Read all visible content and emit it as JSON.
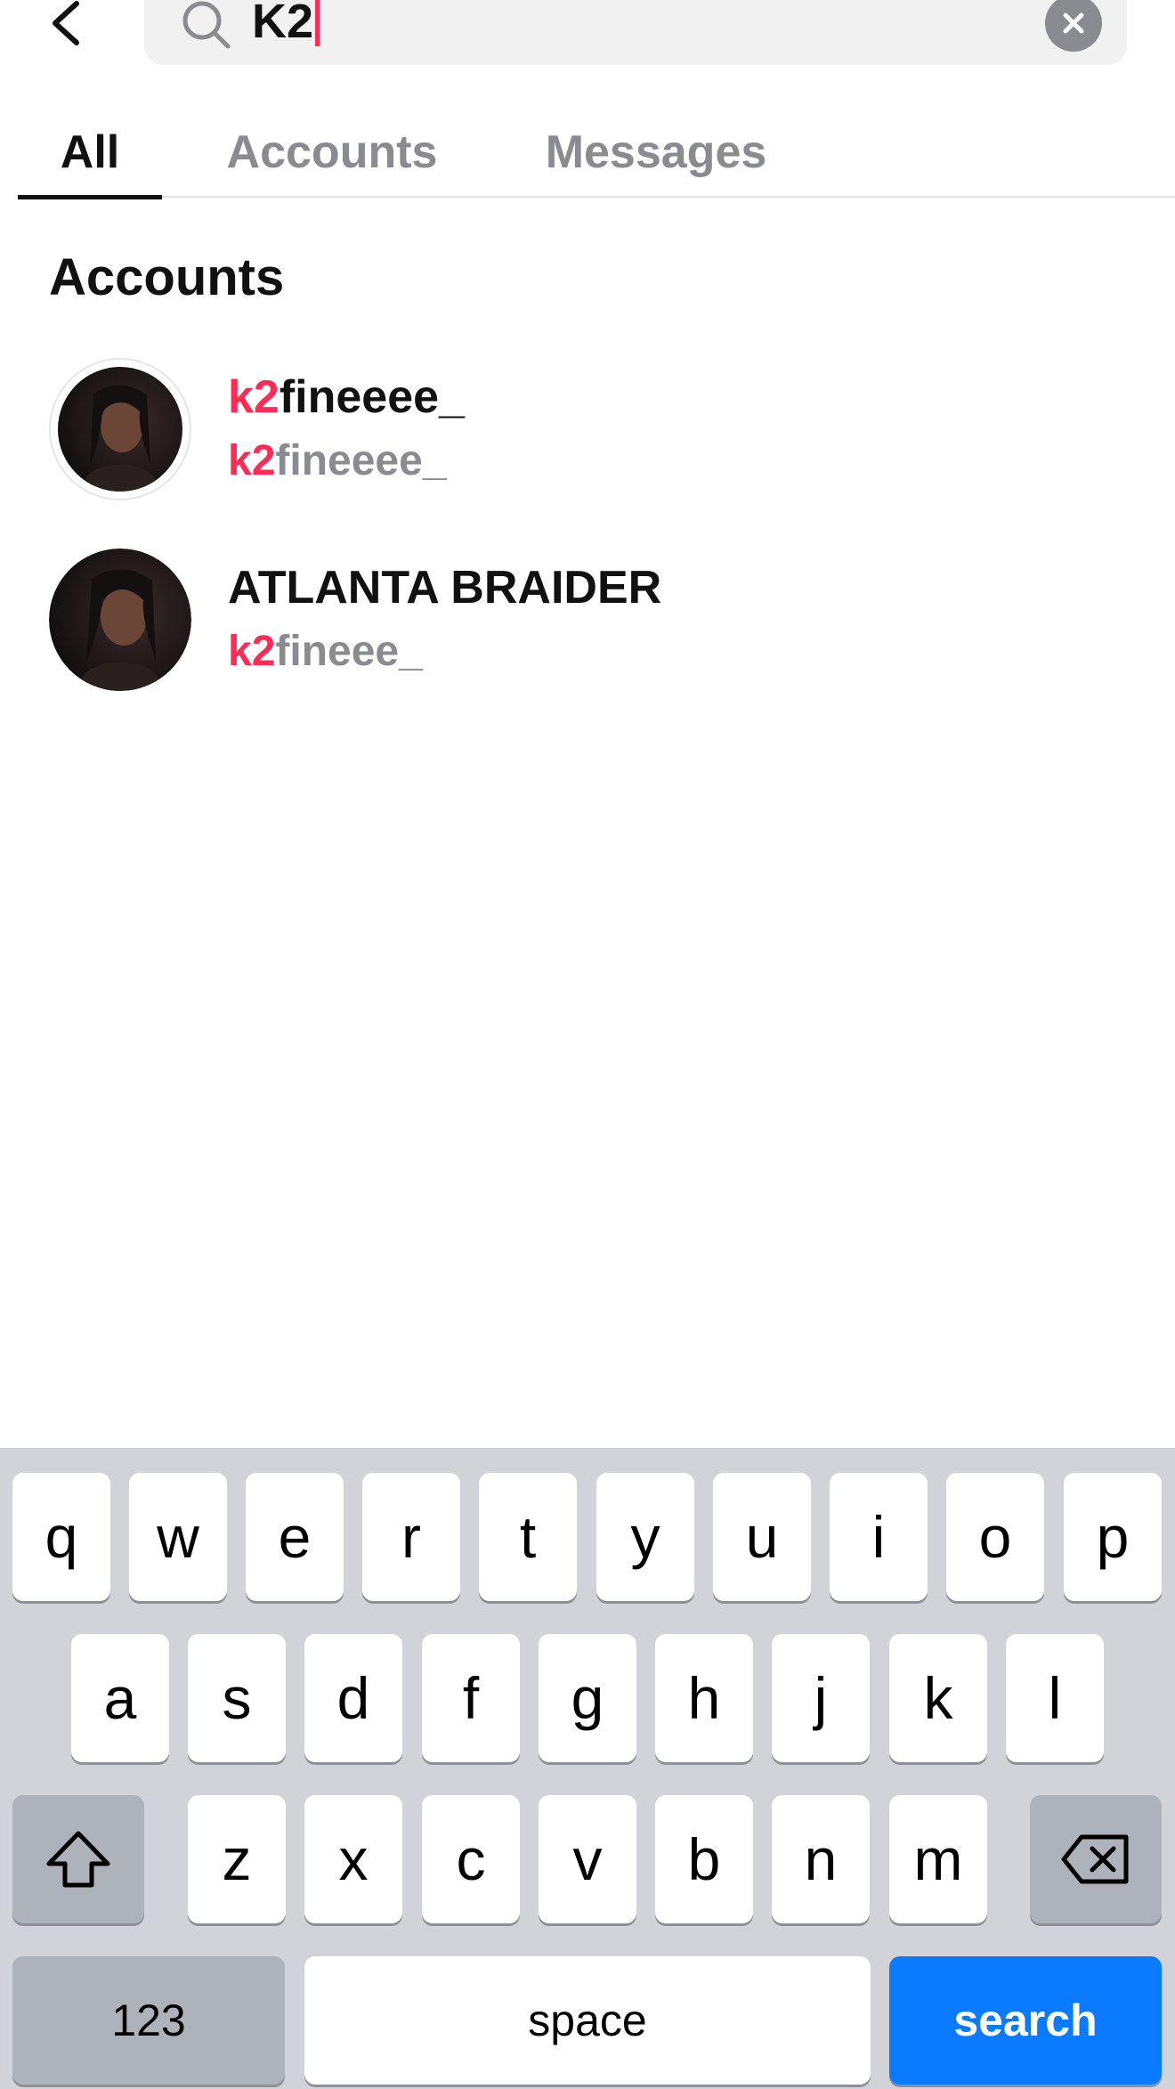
{
  "search": {
    "query": "K2",
    "icon": "search-icon",
    "clear_icon": "clear-icon",
    "back_icon": "chevron-left-icon"
  },
  "tabs": [
    {
      "label": "All",
      "active": true
    },
    {
      "label": "Accounts",
      "active": false
    },
    {
      "label": "Messages",
      "active": false
    }
  ],
  "results": {
    "section_title": "Accounts",
    "accounts": [
      {
        "name_highlight": "k2",
        "name_rest": "fineeee_",
        "handle_highlight": "k2",
        "handle_rest": "fineeee_"
      },
      {
        "name": "ATLANTA BRAIDER",
        "handle_highlight": "k2",
        "handle_rest": "fineee_"
      }
    ]
  },
  "keyboard": {
    "row1": [
      "q",
      "w",
      "e",
      "r",
      "t",
      "y",
      "u",
      "i",
      "o",
      "p"
    ],
    "row2": [
      "a",
      "s",
      "d",
      "f",
      "g",
      "h",
      "j",
      "k",
      "l"
    ],
    "row3": [
      "z",
      "x",
      "c",
      "v",
      "b",
      "n",
      "m"
    ],
    "numbers_label": "123",
    "space_label": "space",
    "search_label": "search",
    "shift_icon": "shift-icon",
    "delete_icon": "backspace-icon"
  },
  "colors": {
    "highlight": "#fe2c55",
    "search_key": "#0a7bff",
    "keyboard_bg": "#d1d3d9"
  }
}
